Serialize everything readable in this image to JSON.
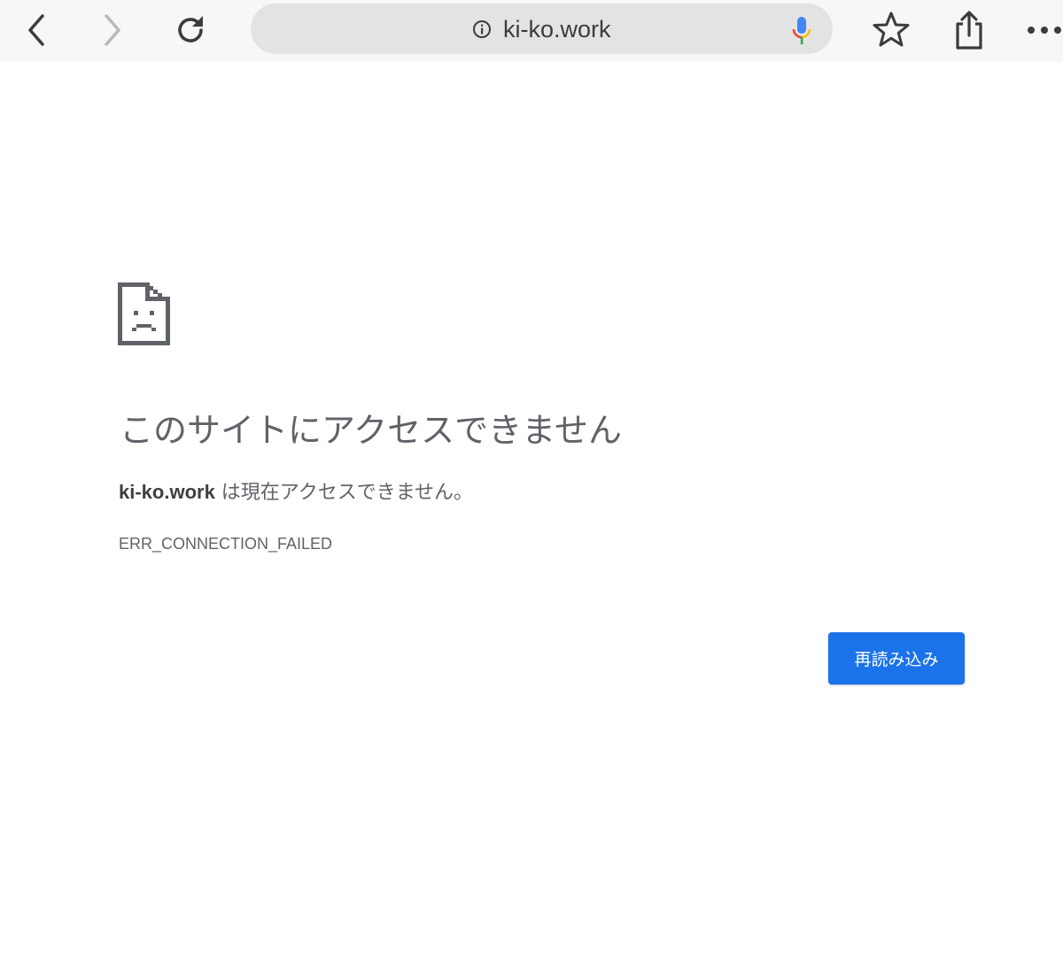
{
  "toolbar": {
    "back": "back-icon",
    "forward": "forward-icon",
    "reload": "reload-icon",
    "url": "ki-ko.work",
    "bookmark": "star-icon",
    "share": "share-icon",
    "menu": "more-icon"
  },
  "error": {
    "icon": "sad-document-icon",
    "heading": "このサイトにアクセスできません",
    "host": "ki-ko.work",
    "message": " は現在アクセスできません。",
    "code": "ERR_CONNECTION_FAILED",
    "reload_label": "再読み込み"
  },
  "colors": {
    "accent": "#1a73e8",
    "text": "#5f6368",
    "toolbar": "#f7f7f7",
    "omnibox": "#e3e3e3"
  }
}
